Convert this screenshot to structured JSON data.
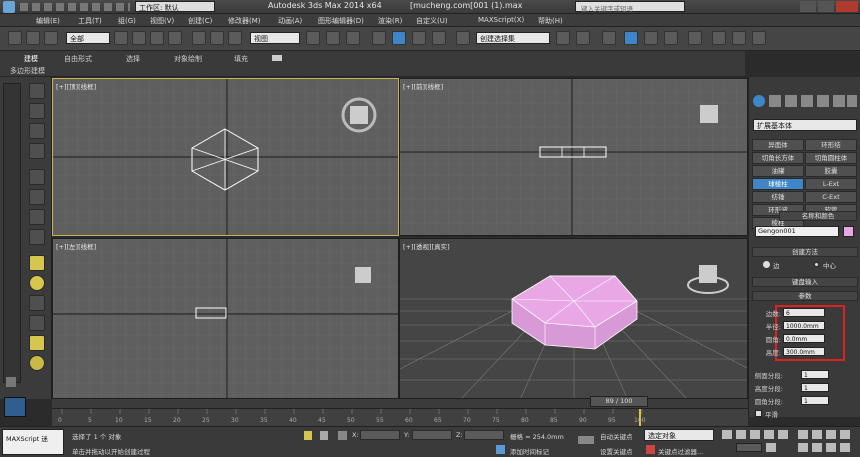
{
  "titlebar": {
    "workspace_label": "工作区: 默认",
    "app_title": "Autodesk 3ds Max  2014 x64",
    "file_title": "[mucheng.com[001 (1).max",
    "search_placeholder": "键入关键字或短语"
  },
  "menus": [
    "编辑(E)",
    "工具(T)",
    "组(G)",
    "视图(V)",
    "创建(C)",
    "修改器(M)",
    "动画(A)",
    "图形编辑器(D)",
    "渲染(R)",
    "自定义(U)",
    "MAXScript(X)",
    "帮助(H)"
  ],
  "toolbar": {
    "selection_filter": "全部",
    "view_coord": "视图",
    "named_selection": "创建选择集"
  },
  "ribbon": {
    "tabs": [
      "建模",
      "自由形式",
      "选择",
      "对象绘制",
      "填充"
    ],
    "subtitle": "多边形建模"
  },
  "viewports": {
    "top": "[+][顶][线框]",
    "front": "[+][前][线框]",
    "left": "[+][左][线框]",
    "perspective": "[+][透视][真实]"
  },
  "command_panel": {
    "category": "扩展基本体",
    "object_type_buttons": [
      "异面体",
      "环形结",
      "切角长方体",
      "切角圆柱体",
      "油罐",
      "胶囊",
      "纺锤",
      "L-Ext",
      "球棱柱",
      "C-Ext",
      "环形波",
      "软管",
      "棱柱"
    ],
    "selected_button": "球棱柱",
    "rollout_name_color": "名称和颜色",
    "object_name": "Gengon001",
    "object_color": "#e9a7e6",
    "rollout_creation": "创建方法",
    "creation_edge": "边",
    "creation_center": "中心",
    "rollout_keyboard": "键盘输入",
    "rollout_params": "参数",
    "params": [
      {
        "label": "边数:",
        "value": "6"
      },
      {
        "label": "半径:",
        "value": "1000.0mm"
      },
      {
        "label": "圆角:",
        "value": "0.0mm"
      },
      {
        "label": "高度:",
        "value": "300.0mm"
      }
    ],
    "segments": [
      {
        "label": "侧面分段:",
        "value": "1"
      },
      {
        "label": "高度分段:",
        "value": "1"
      },
      {
        "label": "圆角分段:",
        "value": "1"
      }
    ],
    "smooth_label": "平滑"
  },
  "timeline": {
    "frame": "89 / 100",
    "ticks": [
      "0",
      "5",
      "10",
      "15",
      "20",
      "25",
      "30",
      "35",
      "40",
      "45",
      "50",
      "55",
      "60",
      "65",
      "70",
      "75",
      "80",
      "85",
      "90",
      "95",
      "100"
    ]
  },
  "status": {
    "maxscript": "MAXScript 迷",
    "selected_msg": "选择了 1 个 对象",
    "hint_msg": "单击并拖动以开始创建过程",
    "x_label": "X:",
    "y_label": "Y:",
    "z_label": "Z:",
    "grid": "栅格 = 254.0mm",
    "add_time_tag": "添加时间标记",
    "auto_key": "自动关键点",
    "set_key": "设置关键点",
    "selected_obj": "选定对象",
    "key_filters": "关键点过滤器..."
  },
  "colors": {
    "accent_blue": "#3f86c8",
    "active_viewport_border": "#c8b24a",
    "object_pink": "#e9a7e6",
    "highlight_red": "#d22"
  }
}
